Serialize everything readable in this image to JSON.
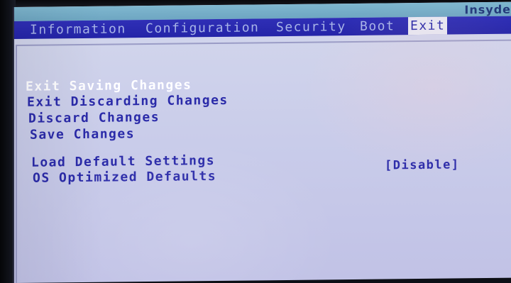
{
  "header": {
    "vendor": "Insyde"
  },
  "tabs": [
    {
      "label": "Information"
    },
    {
      "label": "Configuration"
    },
    {
      "label": "Security"
    },
    {
      "label": "Boot"
    },
    {
      "label": "Exit",
      "active": true
    }
  ],
  "exit_menu": {
    "items": [
      {
        "label": "Exit Saving Changes",
        "selected": true
      },
      {
        "label": "Exit Discarding Changes"
      },
      {
        "label": "Discard Changes"
      },
      {
        "label": "Save Changes"
      },
      {
        "label": "Load Default Settings"
      },
      {
        "label": "OS Optimized Defaults",
        "value": "[Disable]"
      }
    ]
  },
  "colors": {
    "menu_bar": "#2828ac",
    "panel_bg": "#cfd2ea",
    "item_text": "#2b2ba9",
    "selected_text": "#ffffff",
    "title_bar": "#78b0c9"
  }
}
